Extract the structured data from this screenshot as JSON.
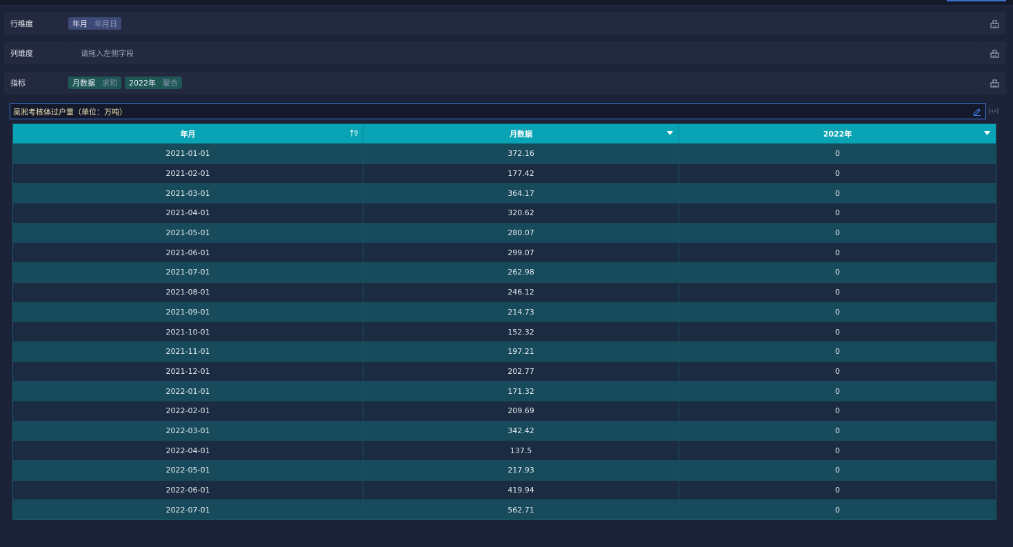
{
  "dimensions": {
    "rows": {
      "label": "行维度",
      "fields": [
        {
          "name": "年月",
          "agg": "年月日"
        }
      ]
    },
    "columns": {
      "label": "列维度",
      "placeholder": "请拖入左侧字段"
    },
    "metrics": {
      "label": "指标",
      "fields": [
        {
          "name": "月数据",
          "agg": "求和"
        },
        {
          "name": "2022年",
          "agg": "聚合"
        }
      ]
    }
  },
  "table_title": "吴淞考核体过户量（单位：万吨）",
  "table": {
    "headers": [
      "年月",
      "月数据",
      "2022年"
    ],
    "rows": [
      [
        "2021-01-01",
        "372.16",
        "0"
      ],
      [
        "2021-02-01",
        "177.42",
        "0"
      ],
      [
        "2021-03-01",
        "364.17",
        "0"
      ],
      [
        "2021-04-01",
        "320.62",
        "0"
      ],
      [
        "2021-05-01",
        "280.07",
        "0"
      ],
      [
        "2021-06-01",
        "299.07",
        "0"
      ],
      [
        "2021-07-01",
        "262.98",
        "0"
      ],
      [
        "2021-08-01",
        "246.12",
        "0"
      ],
      [
        "2021-09-01",
        "214.73",
        "0"
      ],
      [
        "2021-10-01",
        "152.32",
        "0"
      ],
      [
        "2021-11-01",
        "197.21",
        "0"
      ],
      [
        "2021-12-01",
        "202.77",
        "0"
      ],
      [
        "2022-01-01",
        "171.32",
        "0"
      ],
      [
        "2022-02-01",
        "209.69",
        "0"
      ],
      [
        "2022-03-01",
        "342.42",
        "0"
      ],
      [
        "2022-04-01",
        "137.5",
        "0"
      ],
      [
        "2022-05-01",
        "217.93",
        "0"
      ],
      [
        "2022-06-01",
        "419.94",
        "0"
      ],
      [
        "2022-07-01",
        "562.71",
        "0"
      ]
    ]
  },
  "colors": {
    "header_bg": "#08a3b5",
    "row_odd": "#174a5a",
    "row_even": "#1b2b41",
    "accent": "#3b7be0"
  },
  "icons": {
    "dimension_tool": "clear-icon",
    "title_edit": "pencil-icon",
    "sort": "sort-ascending-icon",
    "dropdown": "triangle-down-icon"
  }
}
